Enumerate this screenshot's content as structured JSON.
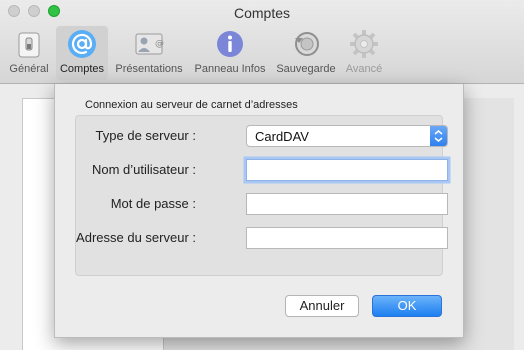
{
  "window": {
    "title": "Comptes"
  },
  "toolbar": {
    "items": [
      {
        "label": "Général",
        "icon": "general-switch-icon"
      },
      {
        "label": "Comptes",
        "icon": "at-sign-icon"
      },
      {
        "label": "Présentations",
        "icon": "templates-icon"
      },
      {
        "label": "Panneau Infos",
        "icon": "info-icon"
      },
      {
        "label": "Sauvegarde",
        "icon": "backup-icon"
      },
      {
        "label": "Avancé",
        "icon": "gear-icon"
      }
    ]
  },
  "sheet": {
    "group_title": "Connexion au serveur de carnet d’adresses",
    "fields": {
      "server_type": {
        "label": "Type de serveur :",
        "value": "CardDAV"
      },
      "username": {
        "label": "Nom d’utilisateur :",
        "value": ""
      },
      "password": {
        "label": "Mot de passe :",
        "value": ""
      },
      "server_address": {
        "label": "Adresse du serveur :",
        "value": ""
      }
    },
    "buttons": {
      "cancel": "Annuler",
      "ok": "OK"
    }
  },
  "colors": {
    "accent": "#2f80ee",
    "focus_ring": "#a8c7f5",
    "zoom_button": "#2fc244"
  }
}
